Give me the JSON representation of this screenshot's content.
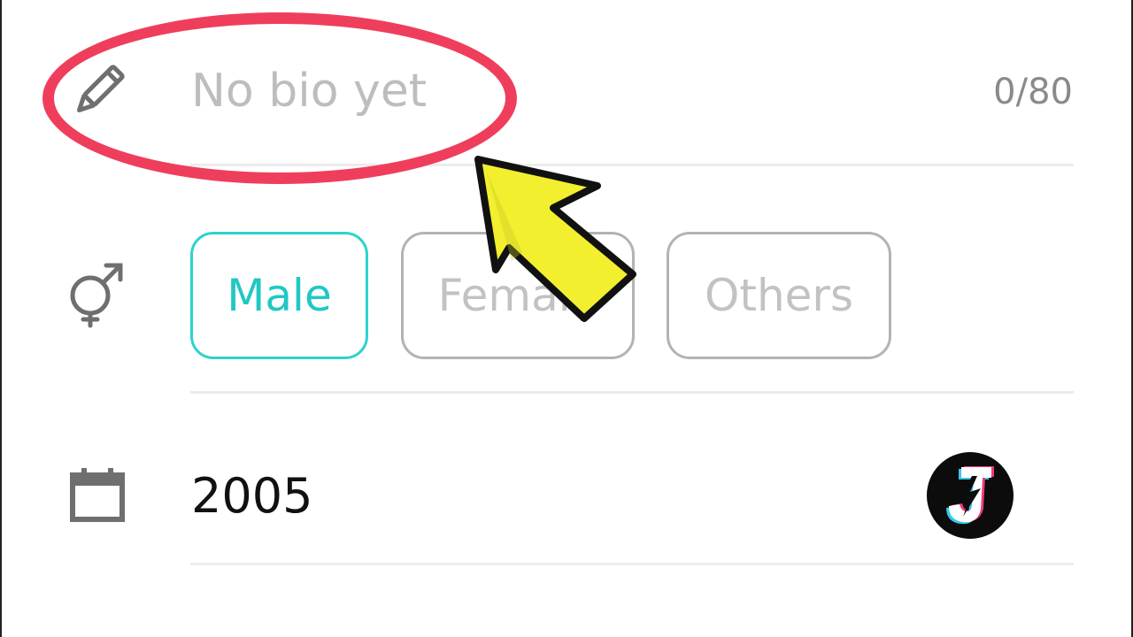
{
  "bio": {
    "placeholder": "No bio yet",
    "counter": "0/80"
  },
  "gender": {
    "options": [
      {
        "label": "Male",
        "selected": true
      },
      {
        "label": "Female",
        "selected": false
      },
      {
        "label": "Others",
        "selected": false
      }
    ]
  },
  "birthday": {
    "year": "2005"
  },
  "icons": {
    "bio": "pencil-icon",
    "gender": "gender-icon",
    "birthday": "calendar-icon",
    "logo": "lightning-j-logo"
  },
  "colors": {
    "accent": "#21c8c3",
    "highlight_ring": "#ef3e5c",
    "arrow_fill": "#f2ef2e",
    "placeholder_text": "#bdbdbd",
    "unselected_border": "#b3b3b3"
  }
}
